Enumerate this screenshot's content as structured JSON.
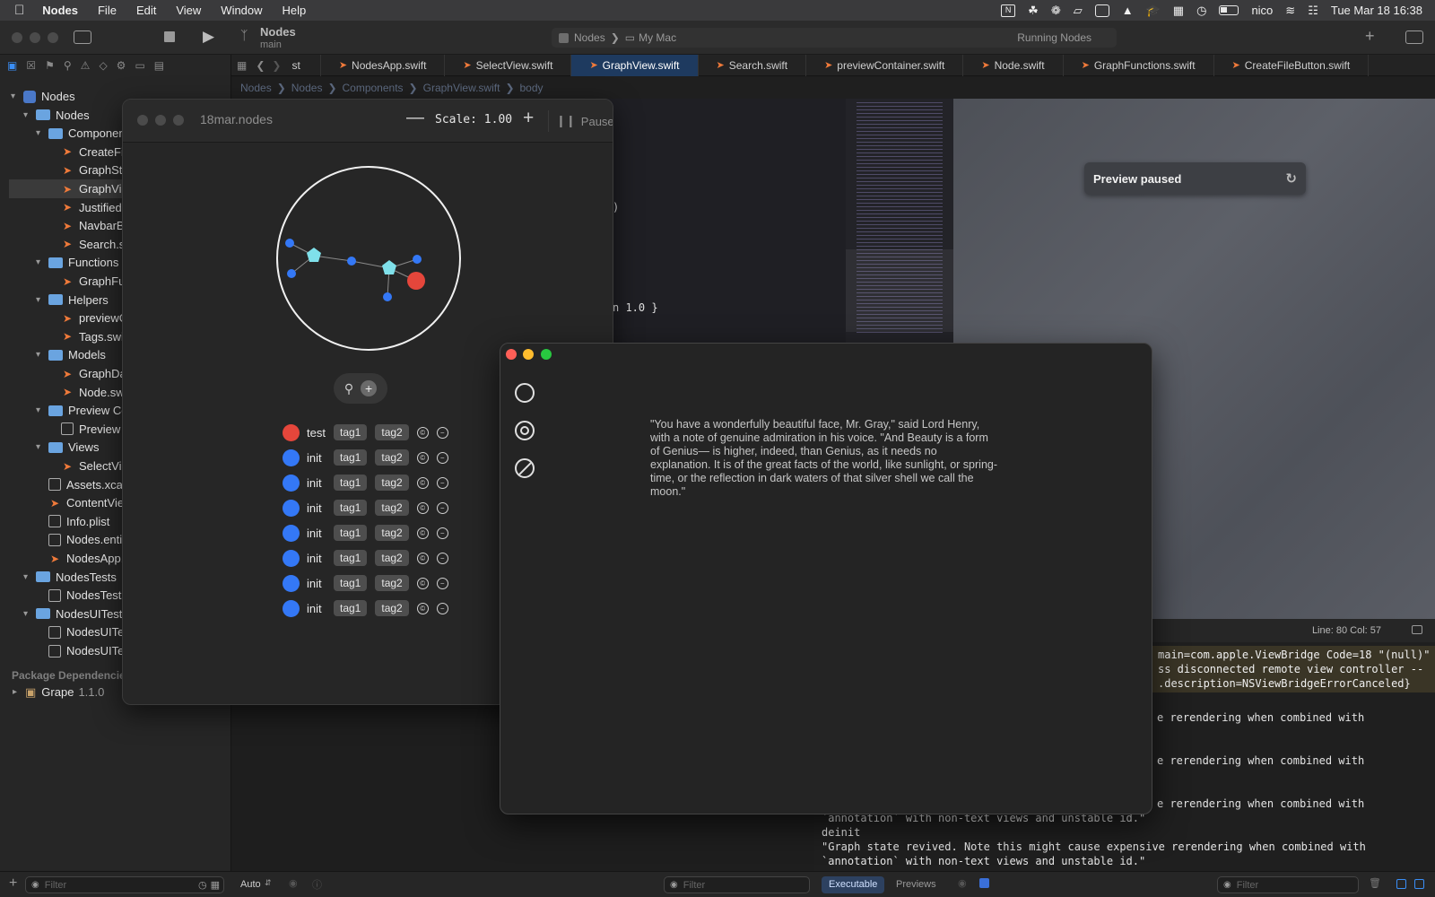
{
  "menubar": {
    "app": "Nodes",
    "items": [
      "File",
      "Edit",
      "View",
      "Window",
      "Help"
    ],
    "user": "nico",
    "clock": "Tue Mar 18  16:38"
  },
  "toolbar": {
    "project": "Nodes",
    "branch": "main",
    "scheme": "Nodes",
    "destination": "My Mac",
    "status": "Running Nodes"
  },
  "tabs": [
    "st",
    "NodesApp.swift",
    "SelectView.swift",
    "GraphView.swift",
    "Search.swift",
    "previewContainer.swift",
    "Node.swift",
    "GraphFunctions.swift",
    "CreateFileButton.swift"
  ],
  "jumpbar": [
    "Nodes",
    "Nodes",
    "Components",
    "GraphView.swift",
    "body"
  ],
  "navigator": {
    "items": [
      {
        "label": "Nodes",
        "indent": 0,
        "kind": "project",
        "open": true
      },
      {
        "label": "Nodes",
        "indent": 1,
        "kind": "folder",
        "open": true
      },
      {
        "label": "Components",
        "indent": 2,
        "kind": "folder",
        "open": true
      },
      {
        "label": "CreateFil",
        "indent": 3,
        "kind": "swift"
      },
      {
        "label": "GraphSta",
        "indent": 3,
        "kind": "swift"
      },
      {
        "label": "GraphVie",
        "indent": 3,
        "kind": "swift",
        "selected": true
      },
      {
        "label": "Justified",
        "indent": 3,
        "kind": "swift"
      },
      {
        "label": "NavbarB",
        "indent": 3,
        "kind": "swift"
      },
      {
        "label": "Search.s",
        "indent": 3,
        "kind": "swift"
      },
      {
        "label": "Functions",
        "indent": 2,
        "kind": "folder",
        "open": true
      },
      {
        "label": "GraphFu",
        "indent": 3,
        "kind": "swift"
      },
      {
        "label": "Helpers",
        "indent": 2,
        "kind": "folder",
        "open": true
      },
      {
        "label": "previewC",
        "indent": 3,
        "kind": "swift"
      },
      {
        "label": "Tags.swi",
        "indent": 3,
        "kind": "swift"
      },
      {
        "label": "Models",
        "indent": 2,
        "kind": "folder",
        "open": true
      },
      {
        "label": "GraphDa",
        "indent": 3,
        "kind": "swift"
      },
      {
        "label": "Node.sw",
        "indent": 3,
        "kind": "swift"
      },
      {
        "label": "Preview Co",
        "indent": 2,
        "kind": "folder",
        "open": true
      },
      {
        "label": "Preview .",
        "indent": 3,
        "kind": "plain"
      },
      {
        "label": "Views",
        "indent": 2,
        "kind": "folder",
        "open": true
      },
      {
        "label": "SelectVie",
        "indent": 3,
        "kind": "swift"
      },
      {
        "label": "Assets.xca",
        "indent": 2,
        "kind": "plain"
      },
      {
        "label": "ContentVie",
        "indent": 2,
        "kind": "swift"
      },
      {
        "label": "Info.plist",
        "indent": 2,
        "kind": "plain"
      },
      {
        "label": "Nodes.enti",
        "indent": 2,
        "kind": "plain"
      },
      {
        "label": "NodesApp.",
        "indent": 2,
        "kind": "swift"
      },
      {
        "label": "NodesTests",
        "indent": 1,
        "kind": "folder",
        "open": true
      },
      {
        "label": "NodesTests",
        "indent": 2,
        "kind": "plain"
      },
      {
        "label": "NodesUITests",
        "indent": 1,
        "kind": "folder",
        "open": true
      },
      {
        "label": "NodesUITe",
        "indent": 2,
        "kind": "plain"
      },
      {
        "label": "NodesUITe",
        "indent": 2,
        "kind": "plain"
      }
    ],
    "package_header": "Package Dependencies",
    "package": "Grape",
    "package_version": "1.1.0",
    "filter_placeholder": "Filter"
  },
  "editor": {
    "line_a": ")",
    "line_b": "n 1.0 }"
  },
  "preview": {
    "paused_label": "Preview paused"
  },
  "console": {
    "cursor": "Line: 80  Col: 57",
    "error_lines": [
      "main=com.apple.ViewBridge Code=18 \"(null)\"",
      "ss disconnected remote view controller --",
      ".description=NSViewBridgeErrorCanceled}"
    ],
    "partial_lines": [
      "e rerendering when combined with",
      "e rerendering when combined with",
      "e rerendering when combined with"
    ],
    "tail": [
      "`annotation` with non-text views and unstable id.\"",
      "deinit",
      "\"Graph state revived. Note this might cause expensive rerendering when combined with",
      "`annotation` with non-text views and unstable id.\""
    ]
  },
  "bottombar": {
    "auto": "Auto",
    "filter_placeholder": "Filter",
    "executable": "Executable",
    "previews": "Previews",
    "filter2_placeholder": "Filter"
  },
  "nodes_window": {
    "title": "18mar.nodes",
    "scale_label": "Scale: 1.00",
    "pause_label": "Pause",
    "rows": [
      {
        "name": "test",
        "color": "#e5463b",
        "tags": [
          "tag1",
          "tag2"
        ]
      },
      {
        "name": "init",
        "color": "#3478f6",
        "tags": [
          "tag1",
          "tag2"
        ]
      },
      {
        "name": "init",
        "color": "#3478f6",
        "tags": [
          "tag1",
          "tag2"
        ]
      },
      {
        "name": "init",
        "color": "#3478f6",
        "tags": [
          "tag1",
          "tag2"
        ]
      },
      {
        "name": "init",
        "color": "#3478f6",
        "tags": [
          "tag1",
          "tag2"
        ]
      },
      {
        "name": "init",
        "color": "#3478f6",
        "tags": [
          "tag1",
          "tag2"
        ]
      },
      {
        "name": "init",
        "color": "#3478f6",
        "tags": [
          "tag1",
          "tag2"
        ]
      },
      {
        "name": "init",
        "color": "#3478f6",
        "tags": [
          "tag1",
          "tag2"
        ]
      }
    ]
  },
  "text_window": {
    "quote": "\"You have a wonderfully beautiful face, Mr. Gray,\" said Lord Henry, with a note of genuine admiration in his voice. \"And Beauty is a form of Genius— is higher, indeed, than Genius, as it needs no explanation. It is of the great facts of the world, like sunlight, or spring-time, or the reflection in dark waters of that silver shell we call the moon.\""
  },
  "colors": {
    "accent": "#3478f6",
    "node_red": "#e5463b",
    "node_cyan": "#7fe0ea"
  }
}
